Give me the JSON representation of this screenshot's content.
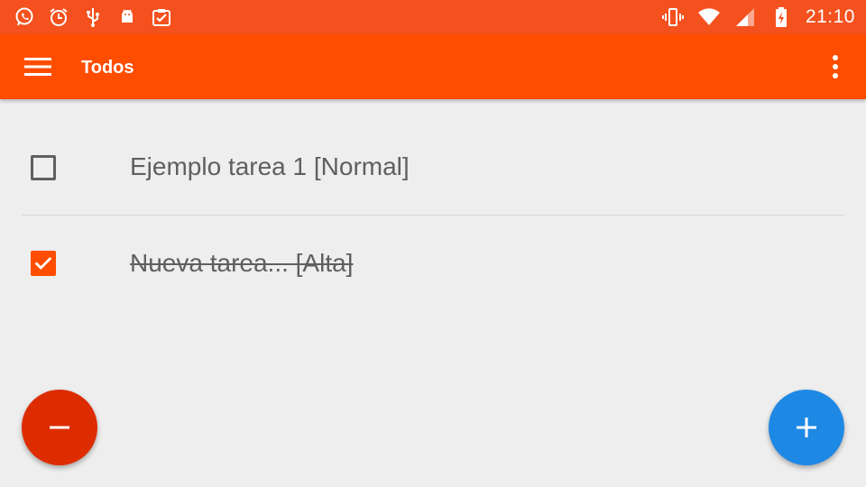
{
  "status_bar": {
    "left_icons": [
      "whatsapp-icon",
      "alarm-icon",
      "usb-icon",
      "android-debug-icon",
      "clipboard-check-icon"
    ],
    "right_icons": [
      "vibrate-icon",
      "wifi-icon",
      "cell-signal-icon",
      "battery-charging-icon"
    ],
    "time": "21:10",
    "color": "#f4511e"
  },
  "toolbar": {
    "title": "Todos",
    "menu_icon": "hamburger-menu-icon",
    "overflow_icon": "more-vert-icon",
    "color": "#ff4d00"
  },
  "todos": [
    {
      "text": "Ejemplo tarea 1 [Normal]",
      "checked": false
    },
    {
      "text": "Nueva tarea... [Alta]",
      "checked": true
    }
  ],
  "fabs": {
    "remove": {
      "icon": "minus-icon",
      "color": "#dd2c00"
    },
    "add": {
      "icon": "plus-icon",
      "color": "#1e88e5"
    }
  },
  "colors": {
    "background": "#eeeeee",
    "text": "#5f5f5f",
    "accent": "#ff4d00"
  }
}
